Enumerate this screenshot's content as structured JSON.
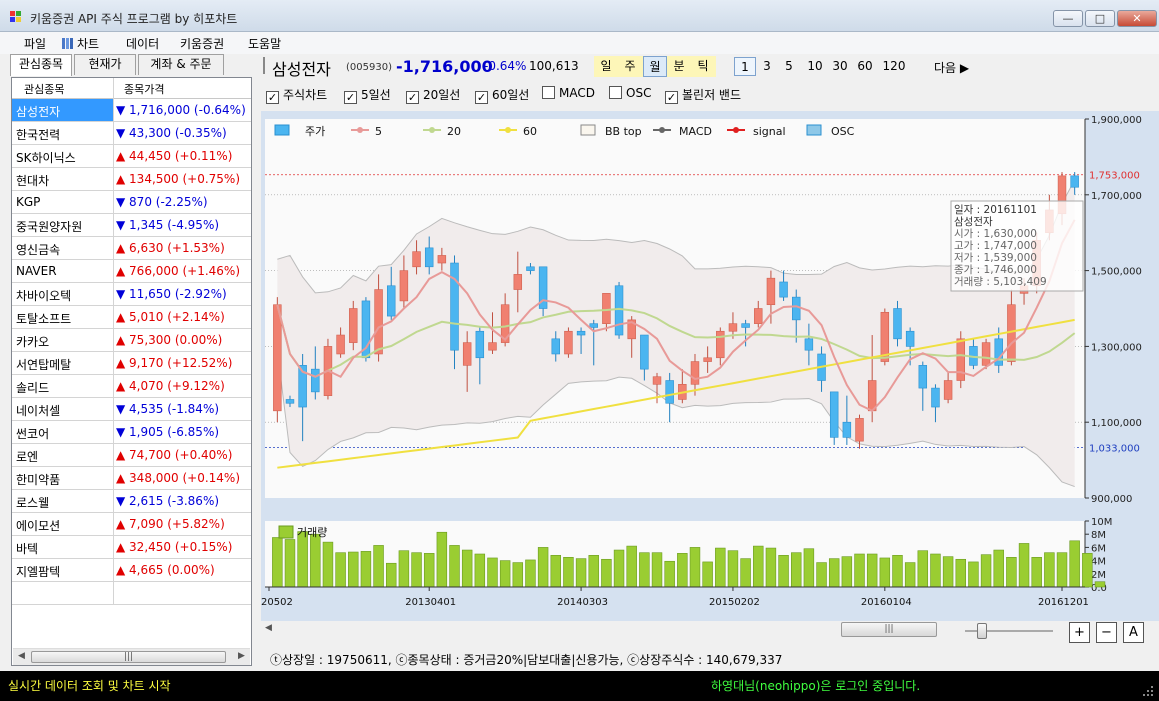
{
  "window": {
    "title": "키움증권 API 주식 프로그램 by 히포차트",
    "min": "—",
    "max": "□",
    "close": "✕"
  },
  "menu": [
    "파일",
    "차트",
    "데이터",
    "키움증권",
    "도움말"
  ],
  "left_tabs": [
    "관심종목",
    "현재가",
    "계좌 & 주문"
  ],
  "watchlist": {
    "headers": [
      "관심종목",
      "종목가격"
    ],
    "rows": [
      {
        "name": "삼성전자",
        "price": "▼ 1,716,000 (-0.64%)",
        "dir": "dn"
      },
      {
        "name": "한국전력",
        "price": "▼ 43,300 (-0.35%)",
        "dir": "dn"
      },
      {
        "name": "SK하이닉스",
        "price": "▲ 44,450 (+0.11%)",
        "dir": "up"
      },
      {
        "name": "현대차",
        "price": "▲ 134,500 (+0.75%)",
        "dir": "up"
      },
      {
        "name": "KGP",
        "price": "▼ 870 (-2.25%)",
        "dir": "dn"
      },
      {
        "name": "중국원양자원",
        "price": "▼ 1,345 (-4.95%)",
        "dir": "dn"
      },
      {
        "name": "영신금속",
        "price": "▲ 6,630 (+1.53%)",
        "dir": "up"
      },
      {
        "name": "NAVER",
        "price": "▲ 766,000 (+1.46%)",
        "dir": "up"
      },
      {
        "name": "차바이오텍",
        "price": "▼ 11,650 (-2.92%)",
        "dir": "dn"
      },
      {
        "name": "토탈소프트",
        "price": "▲ 5,010 (+2.14%)",
        "dir": "up"
      },
      {
        "name": "카카오",
        "price": "▲ 75,300 (0.00%)",
        "dir": "up"
      },
      {
        "name": "서연탑메탈",
        "price": "▲ 9,170 (+12.52%)",
        "dir": "up"
      },
      {
        "name": "솔리드",
        "price": "▲ 4,070 (+9.12%)",
        "dir": "up"
      },
      {
        "name": "네이처셀",
        "price": "▼ 4,535 (-1.84%)",
        "dir": "dn"
      },
      {
        "name": "썬코어",
        "price": "▼ 1,905 (-6.85%)",
        "dir": "dn"
      },
      {
        "name": "로엔",
        "price": "▲ 74,700 (+0.40%)",
        "dir": "up"
      },
      {
        "name": "한미약품",
        "price": "▲ 348,000 (+0.14%)",
        "dir": "up"
      },
      {
        "name": "로스웰",
        "price": "▼ 2,615 (-3.86%)",
        "dir": "dn"
      },
      {
        "name": "에이모션",
        "price": "▲ 7,090 (+5.82%)",
        "dir": "up"
      },
      {
        "name": "바텍",
        "price": "▲ 32,450 (+0.15%)",
        "dir": "up"
      },
      {
        "name": "지엘팜텍",
        "price": "▲ 4,665 (0.00%)",
        "dir": "up"
      }
    ]
  },
  "stock": {
    "name": "삼성전자",
    "code": "(005930)",
    "price": "-1,716,000",
    "change": "-0.64%",
    "volume": "100,613"
  },
  "periods": [
    "일",
    "주",
    "월",
    "분",
    "틱"
  ],
  "active_period": "월",
  "minutes": [
    "1",
    "3",
    "5",
    "10",
    "30",
    "60",
    "120"
  ],
  "next_label": "다음 ▶",
  "checks": [
    {
      "label": "주식차트",
      "checked": true
    },
    {
      "label": "5일선",
      "checked": true
    },
    {
      "label": "20일선",
      "checked": true
    },
    {
      "label": "60일선",
      "checked": true
    },
    {
      "label": "MACD",
      "checked": false
    },
    {
      "label": "OSC",
      "checked": false
    },
    {
      "label": "볼린저 밴드",
      "checked": true
    }
  ],
  "colors": {
    "up": "#f08070",
    "down": "#4bb5f0",
    "ma5": "#e89a98",
    "ma20": "#c0d890",
    "ma60": "#f0e040",
    "bb": "#bbbbbb",
    "volume": "#9acd32"
  },
  "chart_data": {
    "type": "line",
    "legend": [
      "주가",
      "5",
      "20",
      "60",
      "BB top",
      "MACD",
      "signal",
      "OSC"
    ],
    "y_ticks": [
      "1,900,000",
      "1,700,000",
      "1,500,000",
      "1,300,000",
      "1,100,000",
      "900,000"
    ],
    "ylim": [
      900000,
      1900000
    ],
    "x_ticks": [
      "20502",
      "20130401",
      "20140303",
      "20150202",
      "20160104",
      "20161201"
    ],
    "hlines": [
      {
        "value": 1753000,
        "label": "1,753,000",
        "color": "#e03030"
      },
      {
        "value": 1033000,
        "label": "1,033,000",
        "color": "#2040c0"
      }
    ],
    "candles": [
      [
        1130000,
        1410000,
        1100000,
        1430000
      ],
      [
        1160000,
        1150000,
        1140000,
        1170000
      ],
      [
        1250000,
        1140000,
        1050000,
        1280000
      ],
      [
        1240000,
        1180000,
        1160000,
        1300000
      ],
      [
        1170000,
        1300000,
        1160000,
        1320000
      ],
      [
        1280000,
        1330000,
        1270000,
        1350000
      ],
      [
        1310000,
        1400000,
        1290000,
        1420000
      ],
      [
        1420000,
        1270000,
        1260000,
        1430000
      ],
      [
        1280000,
        1450000,
        1260000,
        1490000
      ],
      [
        1460000,
        1380000,
        1370000,
        1510000
      ],
      [
        1420000,
        1500000,
        1400000,
        1540000
      ],
      [
        1510000,
        1550000,
        1490000,
        1580000
      ],
      [
        1560000,
        1510000,
        1490000,
        1590000
      ],
      [
        1520000,
        1540000,
        1500000,
        1560000
      ],
      [
        1520000,
        1290000,
        1240000,
        1540000
      ],
      [
        1250000,
        1310000,
        1180000,
        1340000
      ],
      [
        1340000,
        1270000,
        1200000,
        1350000
      ],
      [
        1290000,
        1310000,
        1280000,
        1390000
      ],
      [
        1310000,
        1410000,
        1300000,
        1440000
      ],
      [
        1450000,
        1490000,
        1390000,
        1550000
      ],
      [
        1510000,
        1500000,
        1490000,
        1520000
      ],
      [
        1510000,
        1400000,
        1380000,
        1510000
      ],
      [
        1320000,
        1280000,
        1260000,
        1340000
      ],
      [
        1280000,
        1340000,
        1270000,
        1350000
      ],
      [
        1340000,
        1330000,
        1280000,
        1350000
      ],
      [
        1360000,
        1350000,
        1250000,
        1370000
      ],
      [
        1360000,
        1440000,
        1340000,
        1440000
      ],
      [
        1460000,
        1330000,
        1320000,
        1470000
      ],
      [
        1320000,
        1370000,
        1270000,
        1380000
      ],
      [
        1330000,
        1240000,
        1210000,
        1330000
      ],
      [
        1200000,
        1220000,
        1150000,
        1230000
      ],
      [
        1210000,
        1150000,
        1100000,
        1230000
      ],
      [
        1160000,
        1200000,
        1150000,
        1240000
      ],
      [
        1200000,
        1260000,
        1170000,
        1280000
      ],
      [
        1260000,
        1270000,
        1230000,
        1300000
      ],
      [
        1270000,
        1340000,
        1250000,
        1350000
      ],
      [
        1340000,
        1360000,
        1320000,
        1390000
      ],
      [
        1360000,
        1350000,
        1300000,
        1370000
      ],
      [
        1360000,
        1400000,
        1350000,
        1420000
      ],
      [
        1410000,
        1480000,
        1360000,
        1500000
      ],
      [
        1470000,
        1430000,
        1420000,
        1500000
      ],
      [
        1430000,
        1370000,
        1310000,
        1450000
      ],
      [
        1320000,
        1290000,
        1250000,
        1360000
      ],
      [
        1280000,
        1210000,
        1180000,
        1300000
      ],
      [
        1180000,
        1060000,
        1040000,
        1180000
      ],
      [
        1100000,
        1060000,
        1040000,
        1170000
      ],
      [
        1050000,
        1110000,
        1030000,
        1120000
      ],
      [
        1130000,
        1210000,
        1100000,
        1330000
      ],
      [
        1260000,
        1390000,
        1250000,
        1400000
      ],
      [
        1400000,
        1320000,
        1300000,
        1420000
      ],
      [
        1340000,
        1300000,
        1250000,
        1350000
      ],
      [
        1250000,
        1190000,
        1130000,
        1260000
      ],
      [
        1190000,
        1140000,
        1100000,
        1200000
      ],
      [
        1160000,
        1210000,
        1150000,
        1230000
      ],
      [
        1210000,
        1320000,
        1190000,
        1340000
      ],
      [
        1300000,
        1250000,
        1240000,
        1320000
      ],
      [
        1250000,
        1310000,
        1240000,
        1320000
      ],
      [
        1320000,
        1250000,
        1230000,
        1350000
      ],
      [
        1260000,
        1410000,
        1250000,
        1450000
      ],
      [
        1440000,
        1460000,
        1410000,
        1480000
      ],
      [
        1460000,
        1580000,
        1440000,
        1600000
      ],
      [
        1600000,
        1660000,
        1580000,
        1700000
      ],
      [
        1650000,
        1750000,
        1620000,
        1760000
      ],
      [
        1750000,
        1720000,
        1700000,
        1760000
      ]
    ],
    "volume": {
      "y_ticks": [
        "10M",
        "8M",
        "6M",
        "4M",
        "2M",
        "0.0"
      ],
      "ylim": [
        0,
        10000000
      ],
      "label": "거래량",
      "values": [
        7500000,
        7200000,
        8400000,
        8000000,
        6800000,
        5200000,
        5300000,
        5400000,
        6300000,
        3600000,
        5500000,
        5200000,
        5100000,
        8300000,
        6300000,
        5600000,
        5000000,
        4400000,
        4000000,
        3700000,
        4100000,
        6000000,
        4800000,
        4500000,
        4300000,
        4800000,
        4200000,
        5600000,
        6200000,
        5200000,
        5200000,
        3900000,
        5100000,
        6000000,
        3800000,
        5900000,
        5500000,
        4300000,
        6200000,
        5900000,
        4800000,
        5200000,
        5800000,
        3700000,
        4300000,
        4600000,
        5000000,
        5000000,
        4400000,
        4800000,
        3700000,
        5500000,
        5000000,
        4600000,
        4200000,
        3800000,
        4900000,
        5600000,
        4500000,
        6600000,
        4500000,
        5200000,
        5200000,
        7000000,
        5100000,
        800000
      ]
    },
    "tooltip": {
      "lines": [
        "일자  : 20161101",
        "삼성전자",
        "시가  : 1,630,000",
        "고가  : 1,747,000",
        "저가  : 1,539,000",
        "종가  : 1,746,000",
        "거래량 : 5,103,409"
      ]
    }
  },
  "info_line": "ⓣ상장일 : 19750611, ⓒ종목상태 : 증거금20%|담보대출|신용가능, ⓒ상장주식수 : 140,679,337",
  "zoom_buttons": [
    "+",
    "−",
    "A"
  ],
  "status": {
    "left": "실시간 데이터 조회 및 차트 시작",
    "right": "하영대님(neohippo)은 로그인 중입니다."
  }
}
